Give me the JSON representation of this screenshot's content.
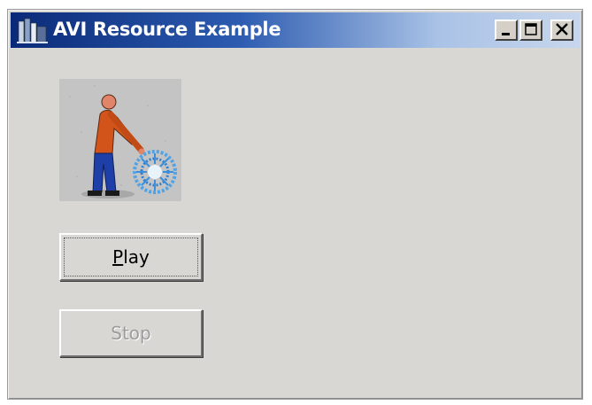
{
  "window": {
    "title": "AVI Resource Example",
    "icons": {
      "app": "bookshelf-app-icon",
      "minimize": "minimize-icon",
      "maximize": "maximize-icon",
      "close": "close-icon"
    }
  },
  "animation": {
    "description_icon": "man-with-wheel-animation"
  },
  "buttons": {
    "play": {
      "mnemonic": "P",
      "rest": "lay",
      "enabled": true
    },
    "stop": {
      "label": "Stop",
      "enabled": false
    }
  },
  "colors": {
    "titlebar_start": "#0a2a78",
    "titlebar_end": "#c7d6ec",
    "window_bg": "#d8d7d3",
    "disabled_text": "#9c9c9c"
  }
}
